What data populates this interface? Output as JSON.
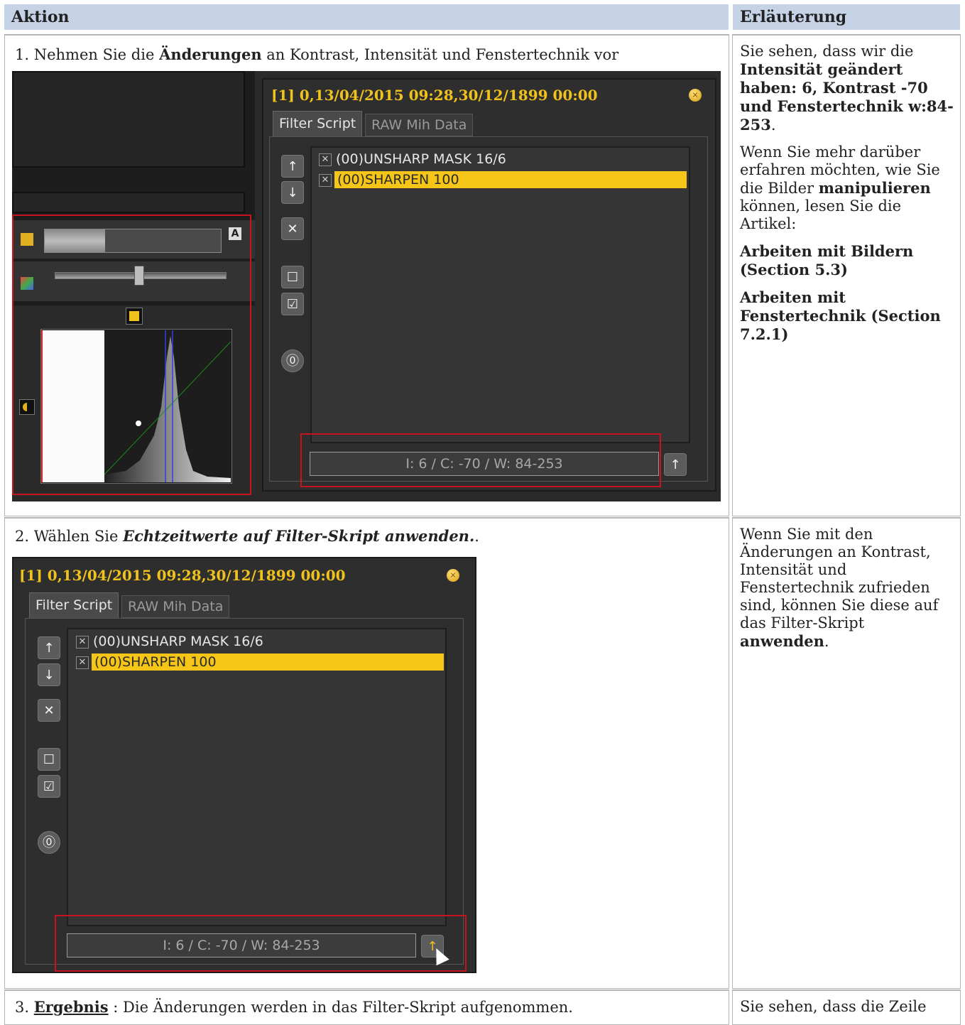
{
  "headers": {
    "aktion": "Aktion",
    "erlaeuterung": "Erläuterung"
  },
  "panel": {
    "title": "[1] 0,13/04/2015 09:28,30/12/1899 00:00",
    "tab_filter": "Filter Script",
    "tab_raw": "RAW Mih Data",
    "items": [
      "(00)UNSHARP MASK 16/6",
      "(00)SHARPEN 100"
    ],
    "status": "I: 6 / C: -70 / W: 84-253",
    "close_icon": "close-icon",
    "colors": {
      "title": "#f0c21e",
      "selected_row": "#f5c518",
      "highlight_box": "#c8141e"
    }
  },
  "row1": {
    "aktion_prefix": "1. Nehmen Sie die ",
    "aktion_bold": "Änderungen",
    "aktion_suffix": " an Kontrast, Intensität und Fenstertechnik vor",
    "histogram_button_label": "A",
    "erl": {
      "p1_a": "Sie sehen, dass wir die ",
      "p1_b": "Intensität geändert haben: 6, Kontrast -70 und Fenstertechnik w:84-253",
      "p1_c": ".",
      "p2_a": "Wenn Sie mehr darüber erfahren möchten, wie Sie die Bilder ",
      "p2_b": "manipulieren",
      "p2_c": " können, lesen Sie die Artikel:",
      "link1": "Arbeiten mit Bildern (Section 5.3)",
      "link2": "Arbeiten mit Fenstertechnik (Section 7.2.1)"
    }
  },
  "row2": {
    "aktion_prefix": "2. Wählen Sie ",
    "aktion_bolditalic": "Echtzeitwerte auf Filter-Skript anwenden.",
    "aktion_suffix": ".",
    "erl_a": "Wenn Sie mit den Änderungen an Kontrast, Intensität und Fenstertechnik zufrieden sind, können Sie diese auf das Filter-Skript ",
    "erl_b": "anwenden",
    "erl_c": "."
  },
  "row3": {
    "aktion_prefix": "3. ",
    "aktion_bold_u": "Ergebnis",
    "aktion_suffix": " : Die Änderungen werden in das Filter-Skript aufgenommen.",
    "erl": "Sie sehen, dass die Zeile"
  }
}
